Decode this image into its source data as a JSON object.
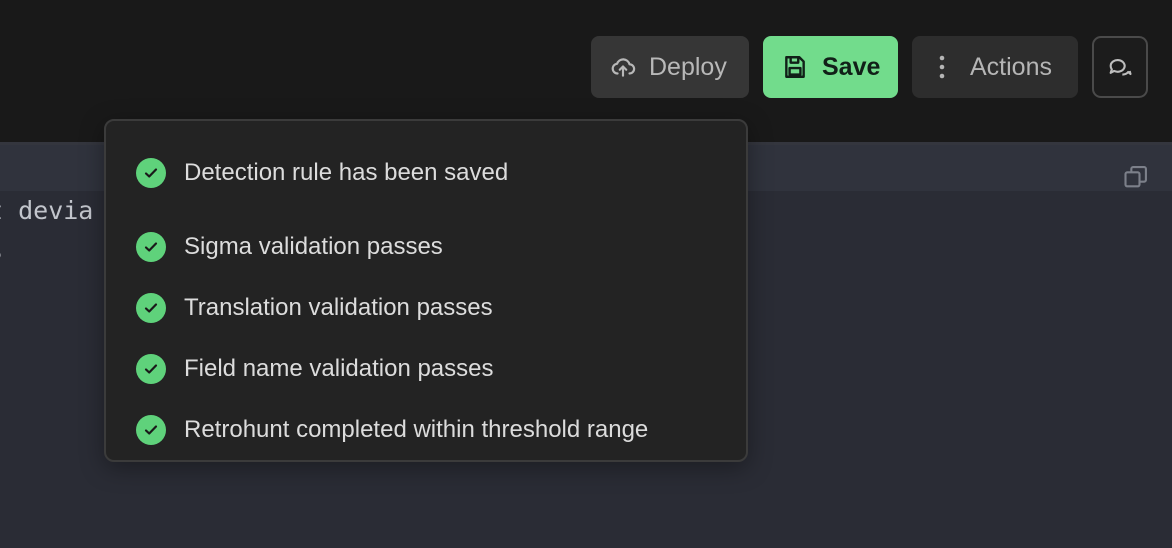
{
  "toolbar": {
    "deploy_label": "Deploy",
    "save_label": "Save",
    "actions_label": "Actions"
  },
  "editor": {
    "code_lines": [
      "t devia",
      "s"
    ]
  },
  "validation_popover": {
    "items": [
      {
        "label": "Detection rule has been saved",
        "status": "passed"
      },
      {
        "label": "Sigma validation passes",
        "status": "passed"
      },
      {
        "label": "Translation validation passes",
        "status": "passed"
      },
      {
        "label": "Field name validation passes",
        "status": "passed"
      },
      {
        "label": "Retrohunt completed within threshold range",
        "status": "passed"
      }
    ]
  },
  "colors": {
    "save_accent": "#72dc8c",
    "check_green": "#5fd27b"
  }
}
